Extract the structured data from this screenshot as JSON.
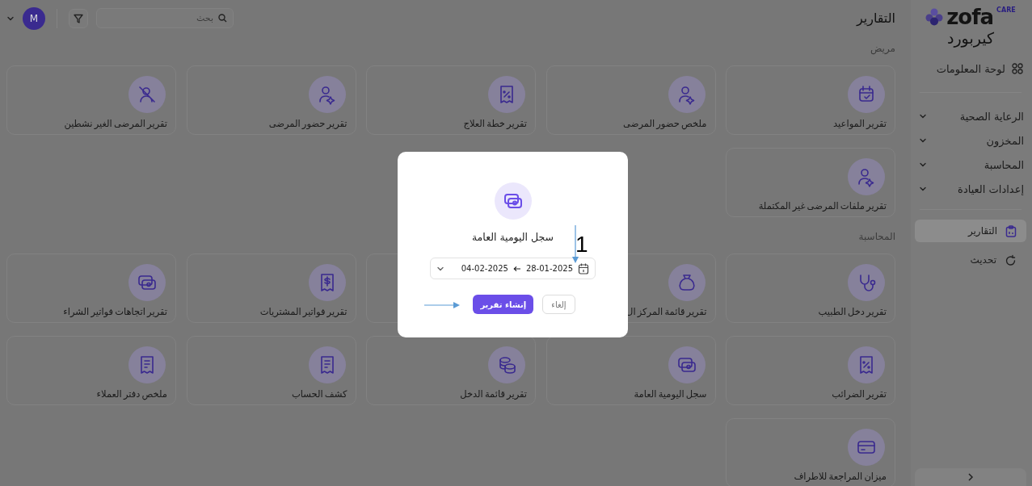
{
  "sidebar": {
    "logo": {
      "name": "zofa",
      "tag": "CARE"
    },
    "clinic": "كيربورد",
    "top_items": [
      {
        "label": "لوحة المعلومات",
        "kind": "dashboard"
      }
    ],
    "groups": [
      {
        "label": "الرعاية الصحية",
        "expanded": false
      },
      {
        "label": "المخزون",
        "expanded": false
      },
      {
        "label": "المحاسبة",
        "expanded": false
      },
      {
        "label": "إعدادات العيادة",
        "expanded": false
      }
    ],
    "links": [
      {
        "label": "التقارير",
        "kind": "reports",
        "selected": true
      },
      {
        "label": "تحديث",
        "kind": "refresh",
        "selected": false
      }
    ]
  },
  "header": {
    "title": "التقارير",
    "search": {
      "placeholder": "بحث"
    },
    "avatar": "M"
  },
  "sections": [
    {
      "title": "مريض",
      "cards": [
        {
          "title": "تقرير المواعيد",
          "kind": "calendar"
        },
        {
          "title": "ملخص حضور المرضى",
          "kind": "user-plus"
        },
        {
          "title": "تقرير خطة العلاج",
          "kind": "receipt-percent"
        },
        {
          "title": "تقرير حضور المرضى",
          "kind": "user-plus"
        },
        {
          "title": "تقرير المرضى الغير نشطين",
          "kind": "user-off"
        },
        {
          "title": "تقرير ملفات المرضى غير المكتملة",
          "kind": "user-plus"
        }
      ]
    },
    {
      "title": "المحاسبة",
      "cards": [
        {
          "title": "تقرير دخل الطبيب",
          "kind": "stethoscope"
        },
        {
          "title": "تقرير قائمة المركز ال",
          "kind": "bag"
        },
        {
          "kind": "blank"
        },
        {
          "title": "تقرير فواتير المشتريات",
          "kind": "receipt-dollar"
        },
        {
          "title": "تقرير اتجاهات فواتير الشراء",
          "kind": "cash"
        },
        {
          "title": "تقرير الضرائب",
          "kind": "receipt-percent"
        },
        {
          "title": "سجل اليومية العامة",
          "kind": "cash"
        },
        {
          "title": "تقرير قائمة الدخل",
          "kind": "coins"
        },
        {
          "title": "كشف الحساب",
          "kind": "receipt"
        },
        {
          "title": "ملخص دفتر العملاء",
          "kind": "receipt"
        },
        {
          "title": "ميزان المراجعة للاطراف",
          "kind": "card"
        }
      ]
    }
  ],
  "modal": {
    "title": "سجل اليومية العامة",
    "kind": "cash",
    "date_from": "28-01-2025",
    "date_to": "04-02-2025",
    "buttons": [
      {
        "label": "إلغاء",
        "kind": "secondary"
      },
      {
        "label": "إنشاء تقرير",
        "kind": "primary"
      }
    ],
    "callout": "1"
  }
}
